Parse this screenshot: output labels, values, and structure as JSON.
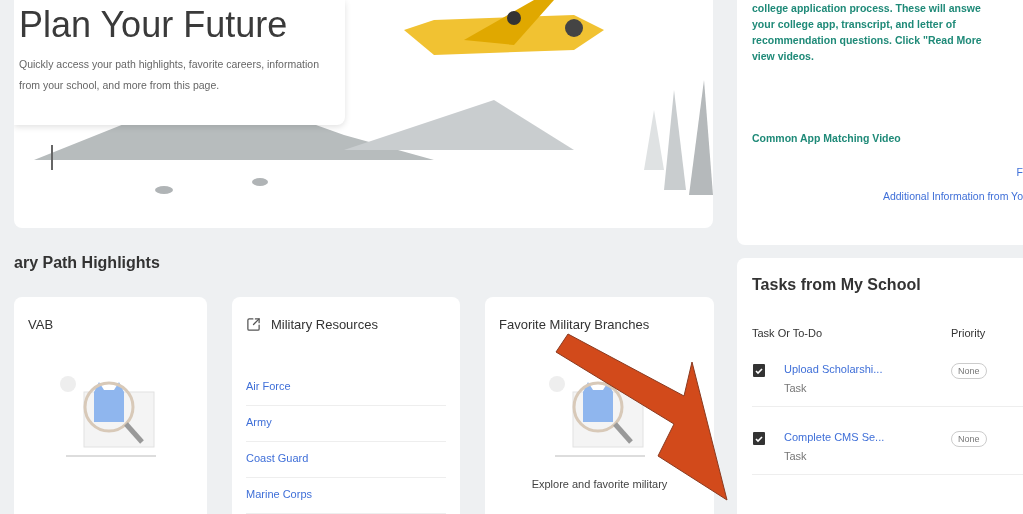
{
  "hero": {
    "title": "Plan Your Future",
    "description": "Quickly access your path highlights, favorite careers, information from your school, and more from this page."
  },
  "info_panel": {
    "lines": [
      "college application process. These will answe",
      "your college app, transcript, and letter of",
      "recommendation questions. Click \"Read More",
      "view videos."
    ],
    "video_title": "Common App Matching Video",
    "links": [
      "F",
      "Additional Information from Yo"
    ]
  },
  "section_title": "ary Path Highlights",
  "cards": [
    {
      "kind": "empty",
      "title": "VAB"
    },
    {
      "kind": "links",
      "title": "Military Resources",
      "links": [
        "Air Force",
        "Army",
        "Coast Guard",
        "Marine Corps"
      ]
    },
    {
      "kind": "empty",
      "title": "Favorite Military Branches",
      "description": "Explore and favorite military"
    }
  ],
  "tasks": {
    "title": "Tasks from My School",
    "columns": [
      "Task Or To-Do",
      "Priority"
    ],
    "rows": [
      {
        "name": "Upload Scholarshi...",
        "type": "Task",
        "priority": "None"
      },
      {
        "name": "Complete CMS Se...",
        "type": "Task",
        "priority": "None"
      }
    ]
  }
}
